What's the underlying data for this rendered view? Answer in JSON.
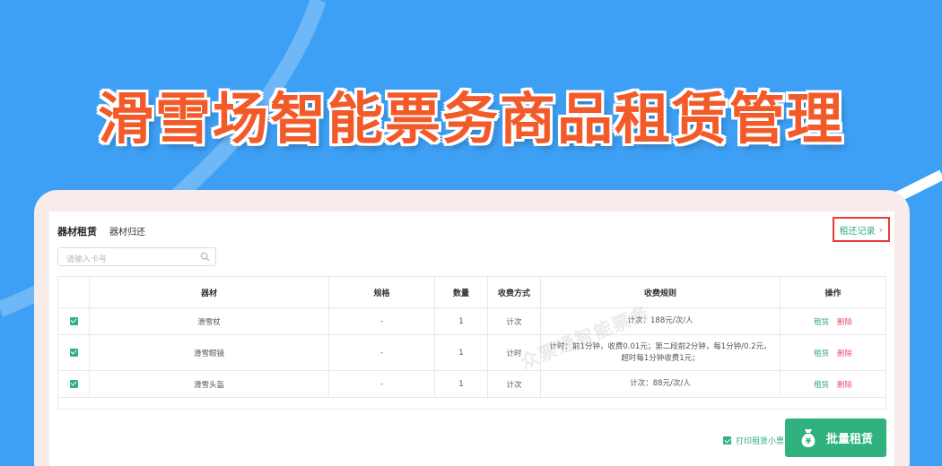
{
  "banner": {
    "title": "滑雪场智能票务商品租赁管理"
  },
  "tabs": {
    "active": "器材租赁",
    "other": "器材归还"
  },
  "records_link": {
    "label": "租还记录"
  },
  "search": {
    "placeholder": "请输入卡号",
    "value": ""
  },
  "table": {
    "headers": [
      "",
      "器材",
      "规格",
      "数量",
      "收费方式",
      "收费规则",
      "操作"
    ],
    "rows": [
      {
        "checked": true,
        "item": "滑雪杖",
        "spec": "-",
        "qty": "1",
        "method": "计次",
        "rule": "计次：188元/次/人",
        "rent": "租赁",
        "del": "删除"
      },
      {
        "checked": true,
        "item": "滑雪眼镜",
        "spec": "-",
        "qty": "1",
        "method": "计时",
        "rule": "计时：前1分钟，收费0.01元；第二段前2分钟，每1分钟/0.2元，超时每1分钟收费1元；",
        "rent": "租赁",
        "del": "删除"
      },
      {
        "checked": true,
        "item": "滑雪头盔",
        "spec": "-",
        "qty": "1",
        "method": "计次",
        "rule": "计次：88元/次/人",
        "rent": "租赁",
        "del": "删除"
      }
    ]
  },
  "watermark": "众票通智能票务",
  "footer": {
    "print_label": "打印租赁小票",
    "print_checked": true,
    "batch_label": "批量租赁",
    "batch_icon": "money-bag-icon"
  },
  "colors": {
    "background": "#3ea0f5",
    "accent": "#2fb27d",
    "title": "#f25a2a",
    "delete": "#f0506e",
    "highlight_box": "#e23b3b"
  }
}
